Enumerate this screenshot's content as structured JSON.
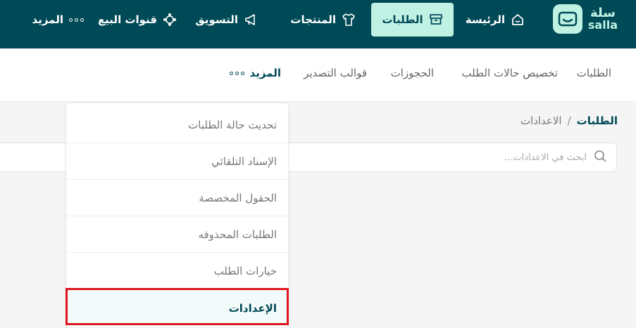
{
  "brand": {
    "name_ar": "سلة",
    "name_en": "salla"
  },
  "topnav": {
    "home": "الرئيسة",
    "orders": "الطلبات",
    "products": "المنتجات",
    "marketing": "التسويق",
    "channels": "قنوات البيع",
    "more": "المزيد"
  },
  "subnav": {
    "orders": "الطلبات",
    "customize_status": "تخصيص حالات الطلب",
    "reservations": "الحجوزات",
    "export_templates": "قوالب التصدير",
    "more": "المزيد"
  },
  "breadcrumb": {
    "parent": "الطلبات",
    "separator": "/",
    "current": "الاعدادات"
  },
  "search": {
    "placeholder": "ابحث في الاعدادات..."
  },
  "dropdown": {
    "items": [
      "تحديث حالة الطلبات",
      "الإسناد التلقائي",
      "الحقول المخصصة",
      "الطلبات المحذوفه",
      "خيارات الطلب",
      "الإعدادات"
    ],
    "selected_index": 5
  },
  "colors": {
    "primary": "#004956",
    "accent": "#bff2e3",
    "highlight_border": "#e0141e"
  }
}
